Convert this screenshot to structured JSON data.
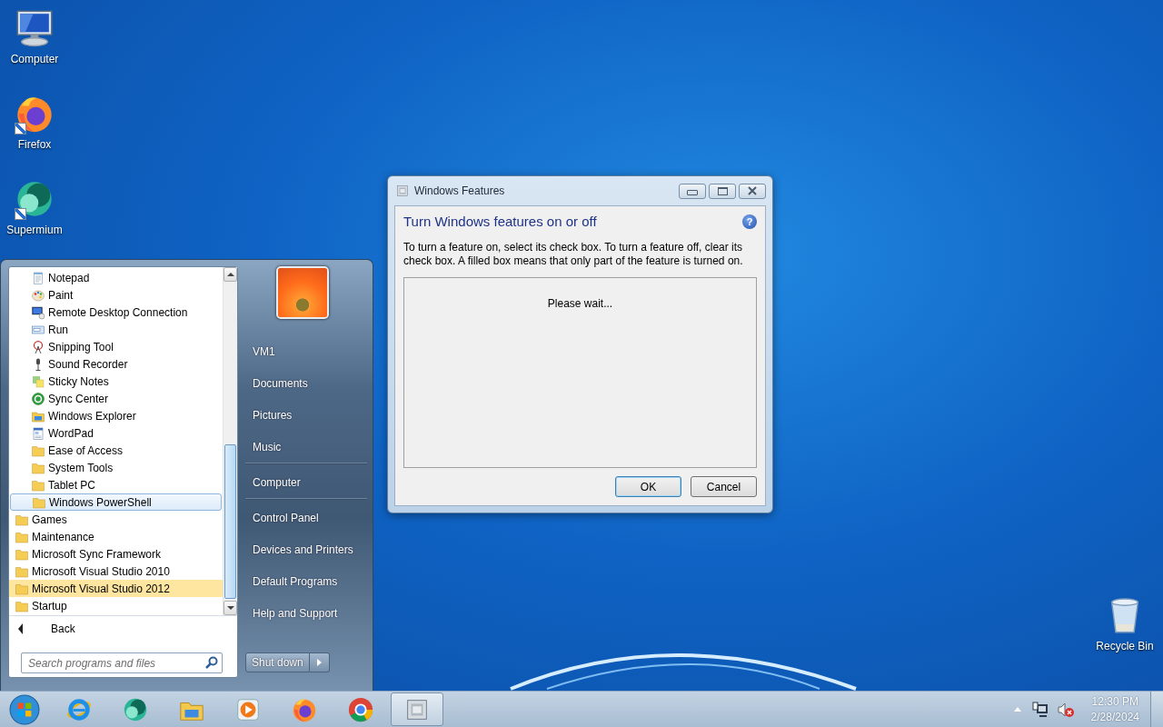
{
  "desktop_icons": [
    {
      "label": "Computer",
      "kind": "computer",
      "shortcut": false
    },
    {
      "label": "Firefox",
      "kind": "firefox",
      "shortcut": true
    },
    {
      "label": "Supermium",
      "kind": "supermium",
      "shortcut": true
    }
  ],
  "recycle_bin": {
    "label": "Recycle Bin",
    "kind": "recycle-bin"
  },
  "start_menu": {
    "accessories": [
      {
        "label": "Notepad",
        "kind": "notepad",
        "hovered": false,
        "new": false
      },
      {
        "label": "Paint",
        "kind": "paint",
        "hovered": false,
        "new": false
      },
      {
        "label": "Remote Desktop Connection",
        "kind": "remote-desktop",
        "hovered": false,
        "new": false
      },
      {
        "label": "Run",
        "kind": "run",
        "hovered": false,
        "new": false
      },
      {
        "label": "Snipping Tool",
        "kind": "snipping",
        "hovered": false,
        "new": false
      },
      {
        "label": "Sound Recorder",
        "kind": "microphone",
        "hovered": false,
        "new": false
      },
      {
        "label": "Sticky Notes",
        "kind": "sticky-notes",
        "hovered": false,
        "new": false
      },
      {
        "label": "Sync Center",
        "kind": "sync",
        "hovered": false,
        "new": false
      },
      {
        "label": "Windows Explorer",
        "kind": "explorer",
        "hovered": false,
        "new": false
      },
      {
        "label": "WordPad",
        "kind": "wordpad",
        "hovered": false,
        "new": false
      },
      {
        "label": "Ease of Access",
        "kind": "folder",
        "hovered": false,
        "new": false
      },
      {
        "label": "System Tools",
        "kind": "folder",
        "hovered": false,
        "new": false
      },
      {
        "label": "Tablet PC",
        "kind": "folder",
        "hovered": false,
        "new": false
      },
      {
        "label": "Windows PowerShell",
        "kind": "folder",
        "hovered": true,
        "new": false
      }
    ],
    "program_folders": [
      {
        "label": "Games",
        "kind": "folder",
        "hovered": false,
        "new": false
      },
      {
        "label": "Maintenance",
        "kind": "folder",
        "hovered": false,
        "new": false
      },
      {
        "label": "Microsoft Sync Framework",
        "kind": "folder",
        "hovered": false,
        "new": false
      },
      {
        "label": "Microsoft Visual Studio 2010",
        "kind": "folder",
        "hovered": false,
        "new": false
      },
      {
        "label": "Microsoft Visual Studio 2012",
        "kind": "folder",
        "hovered": false,
        "new": true
      },
      {
        "label": "Startup",
        "kind": "folder",
        "hovered": false,
        "new": false
      }
    ],
    "back": "Back",
    "search": {
      "placeholder": "Search programs and files"
    },
    "places": [
      {
        "label": "VM1",
        "divider_after": false
      },
      {
        "label": "Documents",
        "divider_after": false
      },
      {
        "label": "Pictures",
        "divider_after": false
      },
      {
        "label": "Music",
        "divider_after": true
      },
      {
        "label": "Computer",
        "divider_after": true
      },
      {
        "label": "Control Panel",
        "divider_after": false
      },
      {
        "label": "Devices and Printers",
        "divider_after": false
      },
      {
        "label": "Default Programs",
        "divider_after": false
      },
      {
        "label": "Help and Support",
        "divider_after": false
      }
    ],
    "shut_down": "Shut down"
  },
  "window": {
    "title": "Windows Features",
    "heading": "Turn Windows features on or off",
    "help": "?",
    "description": "To turn a feature on, select its check box. To turn a feature off, clear its check box. A filled box means that only part of the feature is turned on.",
    "status": "Please wait...",
    "buttons": [
      {
        "label": "OK",
        "default": true
      },
      {
        "label": "Cancel",
        "default": false
      }
    ]
  },
  "taskbar": {
    "items": [
      {
        "kind": "ie",
        "active": false
      },
      {
        "kind": "supermium",
        "active": false
      },
      {
        "kind": "explorer",
        "active": false
      },
      {
        "kind": "media-player",
        "active": false
      },
      {
        "kind": "firefox",
        "active": false
      },
      {
        "kind": "chrome",
        "active": false
      },
      {
        "kind": "features",
        "active": true
      }
    ],
    "clock": {
      "time": "12:30 PM",
      "date": "2/28/2024"
    }
  }
}
